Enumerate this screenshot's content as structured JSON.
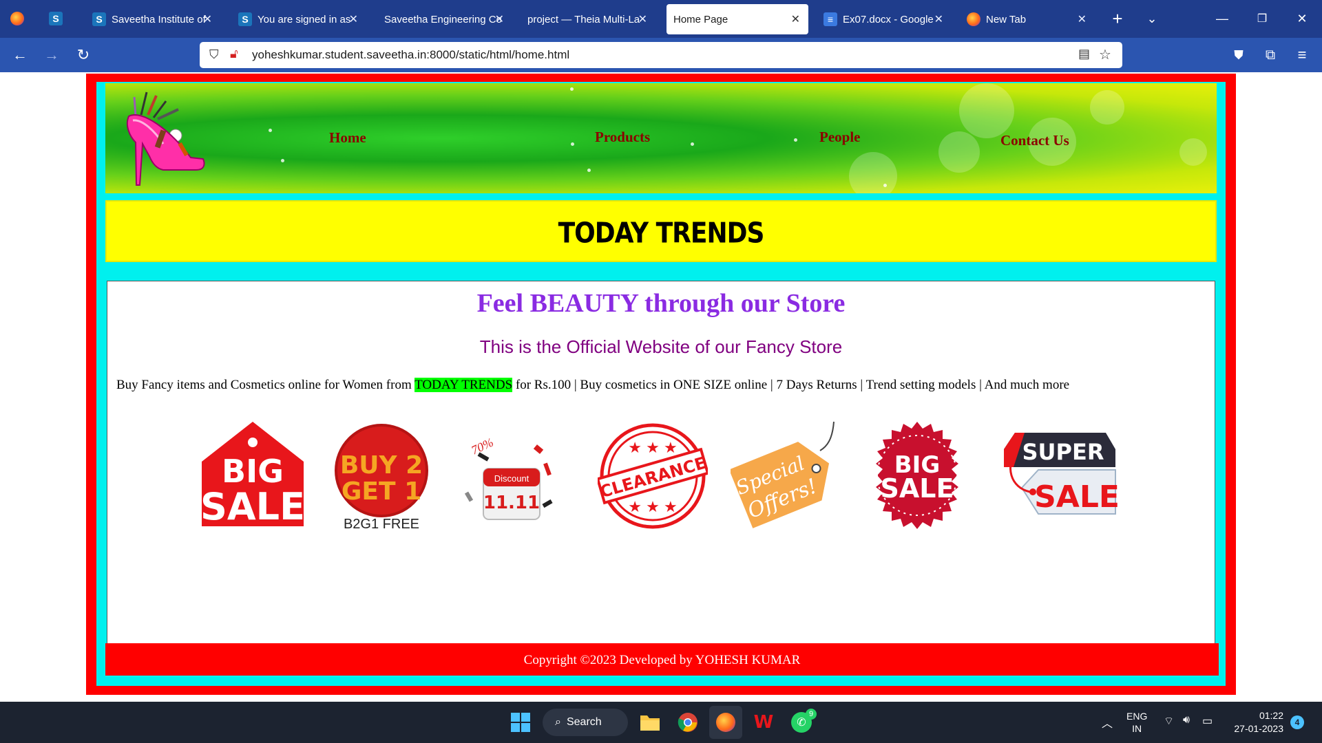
{
  "browser": {
    "tabs": [
      {
        "title": "Saveetha Institute of",
        "icon": "saveetha-s-icon"
      },
      {
        "title": "You are signed in as",
        "icon": "saveetha-s-icon"
      },
      {
        "title": "Saveetha Engineering Co",
        "icon": "none"
      },
      {
        "title": "project — Theia Multi-La",
        "icon": "none"
      },
      {
        "title": "Home Page",
        "icon": "none",
        "active": true
      },
      {
        "title": "Ex07.docx - Google",
        "icon": "google-docs-icon"
      },
      {
        "title": "New Tab",
        "icon": "firefox-icon"
      }
    ],
    "url": "yoheshkumar.student.saveetha.in:8000/static/html/home.html"
  },
  "page": {
    "nav": {
      "home": "Home",
      "products": "Products",
      "people": "People",
      "contact": "Contact Us"
    },
    "banner_title": "TODAY TRENDS",
    "heading": "Feel BEAUTY through our Store",
    "subheading": "This is the Official Website of our Fancy Store",
    "tagline_before": "Buy Fancy items and Cosmetics online for Women from ",
    "tagline_highlight": "TODAY TRENDS",
    "tagline_after": " for Rs.100 | Buy cosmetics in ONE SIZE online | 7 Days Returns | Trend setting models | And much more",
    "badges": {
      "big_sale_1": "BIG",
      "big_sale_2": "SALE",
      "buy2_line1": "BUY 2",
      "buy2_line2": "GET 1",
      "buy2_caption": "B2G1 FREE",
      "discount_label": "Discount",
      "discount_date": "11.11",
      "discount_pct": "70%",
      "clearance": "CLEARANCE",
      "special_1": "Special",
      "special_2": "Offers!",
      "big2_1": "BIG",
      "big2_2": "SALE",
      "super_1": "SUPER",
      "super_2": "SALE"
    },
    "footer": "Copyright ©2023 Developed by YOHESH KUMAR"
  },
  "taskbar": {
    "search": "Search",
    "lang_1": "ENG",
    "lang_2": "IN",
    "time": "01:22",
    "date": "27-01-2023",
    "notif_count": "4",
    "whatsapp_badge": "9"
  },
  "colors": {
    "outer_border": "#ff0000",
    "inner_frame": "#00f0ee",
    "banner": "#ffff00",
    "nav_text": "#8b0000",
    "heading": "#8a2be2",
    "subheading": "#800080",
    "highlight": "#00ff00"
  }
}
